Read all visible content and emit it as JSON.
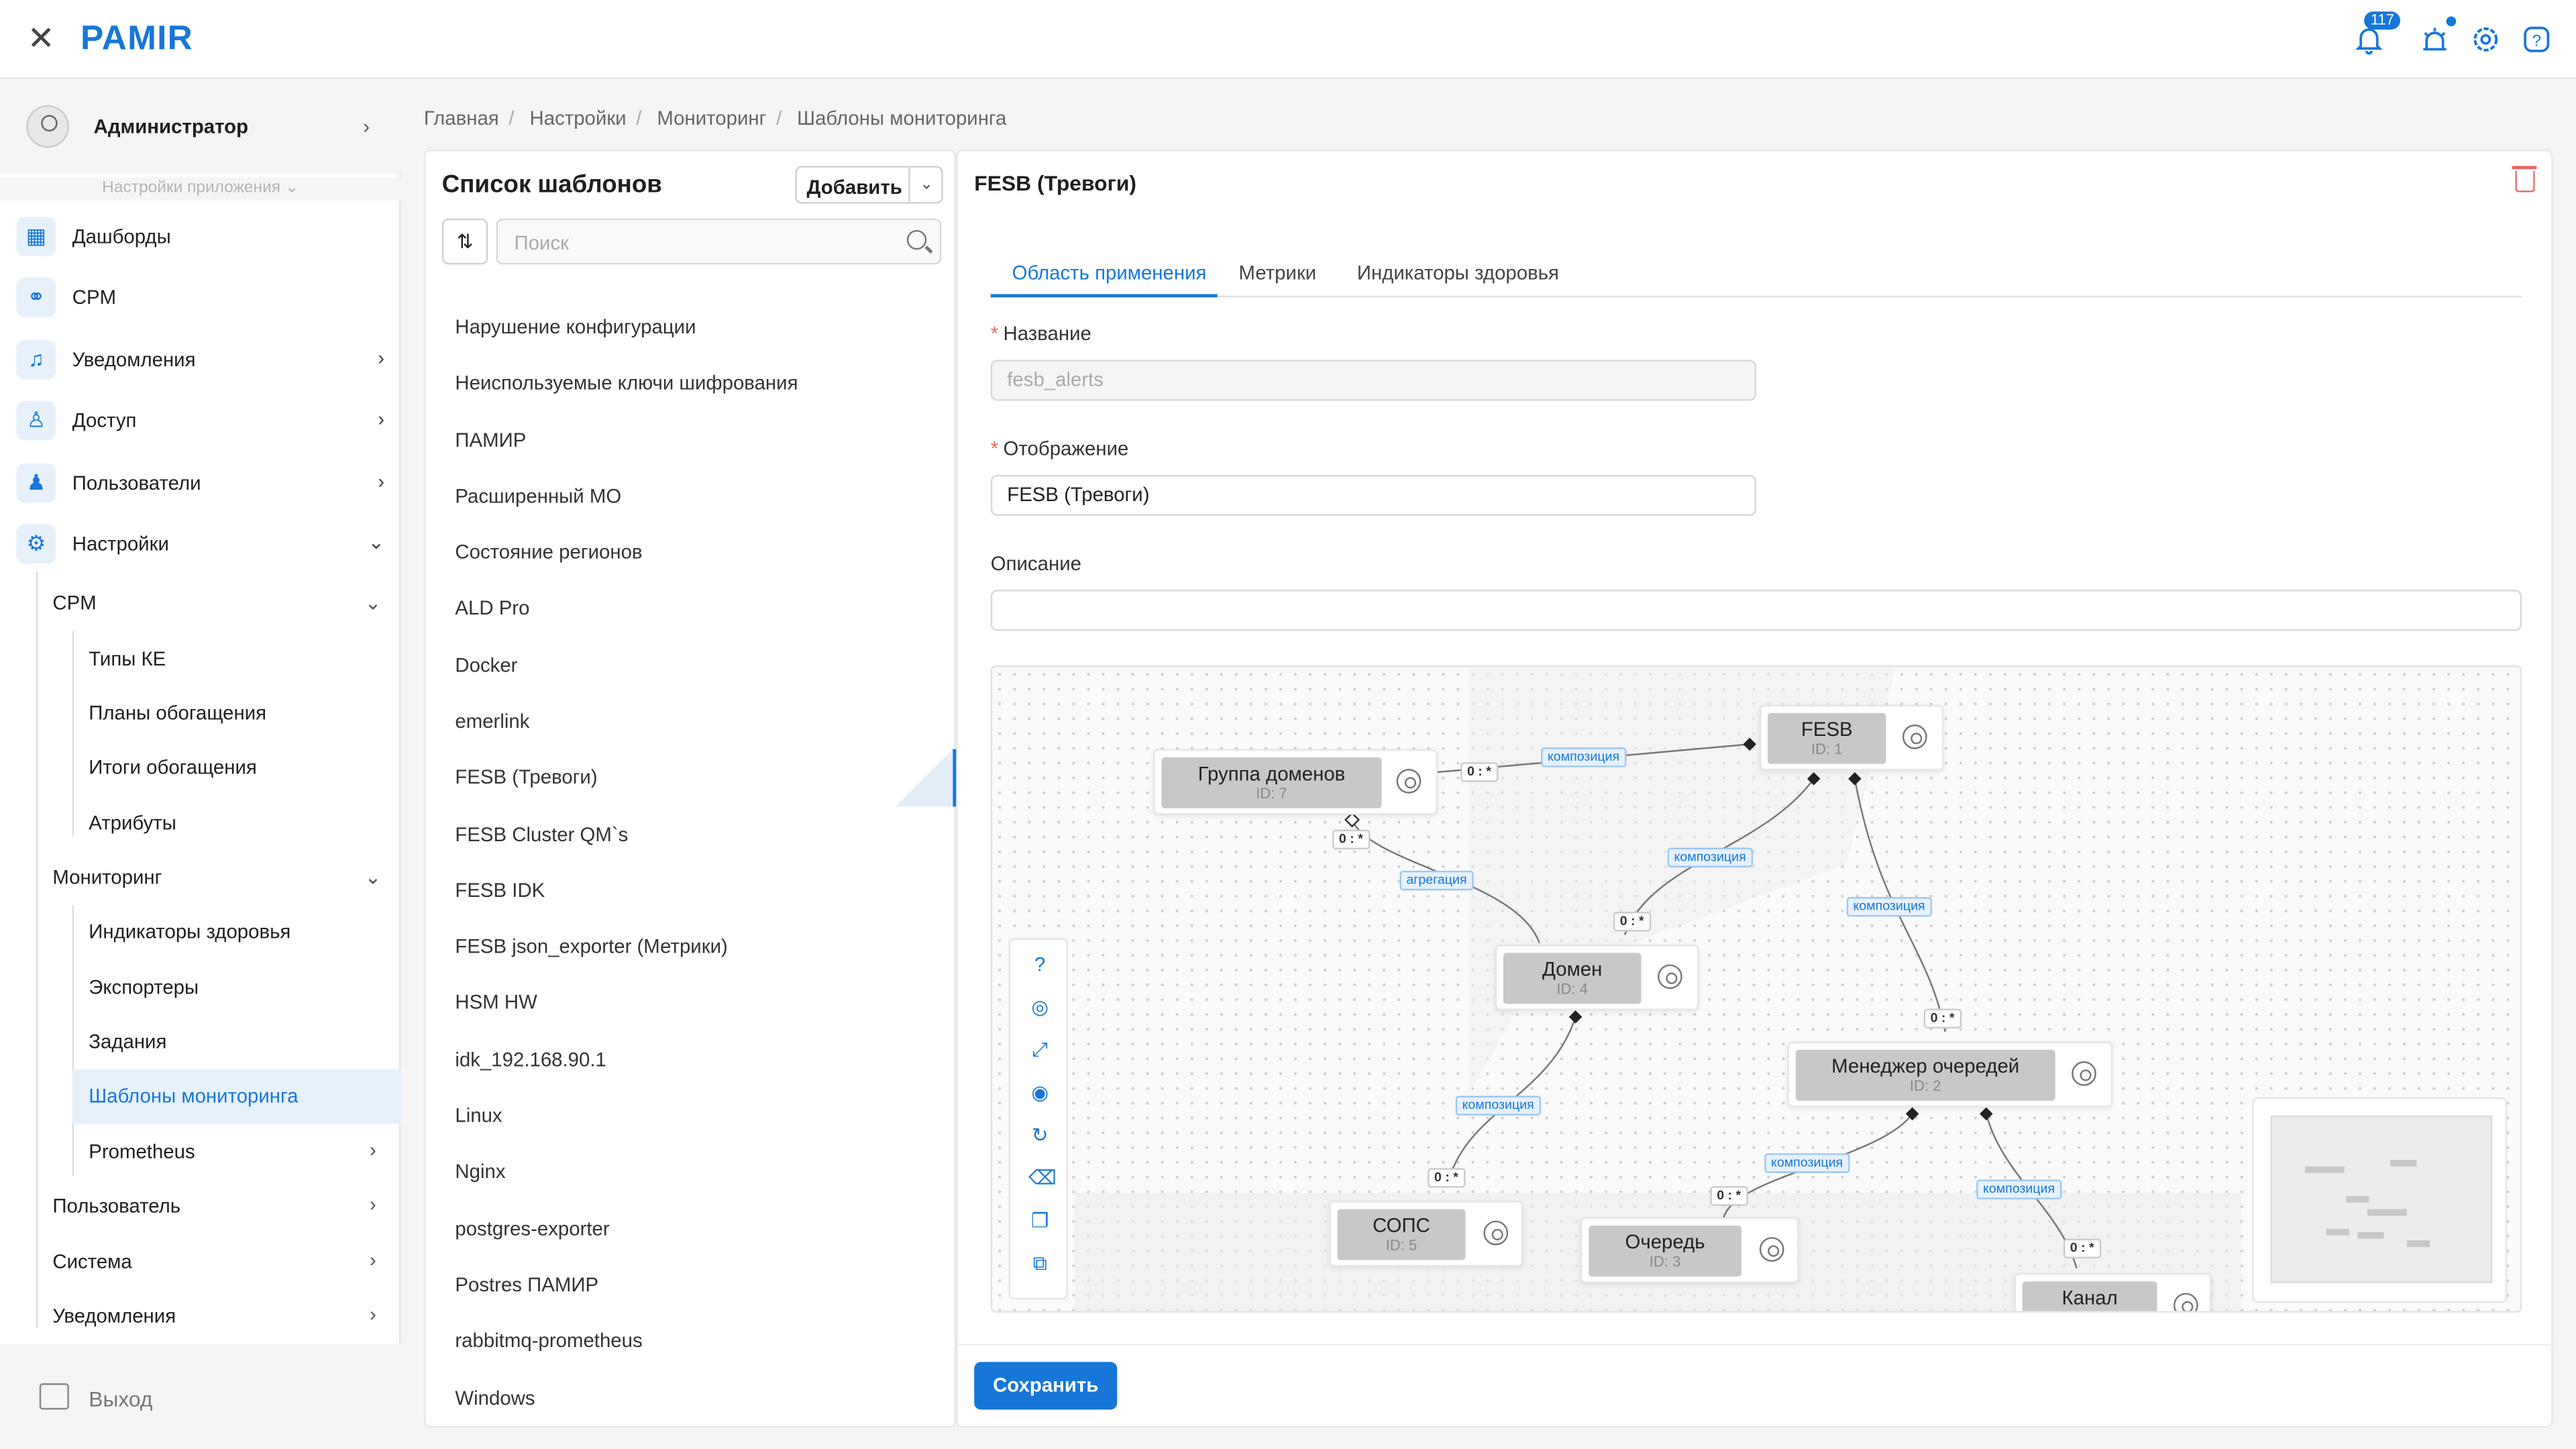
{
  "app": {
    "logo": "PAMIR",
    "notifications_count": "117"
  },
  "sidebar": {
    "user": "Администратор",
    "app_settings": "Настройки приложения",
    "items": [
      {
        "label": "Дашборды",
        "icon": "dashboard-icon"
      },
      {
        "label": "CPM",
        "icon": "cpm-icon"
      },
      {
        "label": "Уведомления",
        "icon": "bell-icon"
      },
      {
        "label": "Доступ",
        "icon": "access-icon"
      },
      {
        "label": "Пользователи",
        "icon": "users-icon"
      },
      {
        "label": "Настройки",
        "icon": "gear-icon"
      }
    ],
    "sub": {
      "cpm": "CPM",
      "cpm_items": [
        "Типы КЕ",
        "Планы обогащения",
        "Итоги обогащения",
        "Атрибуты"
      ],
      "monitoring": "Мониторинг",
      "monitoring_items": [
        "Индикаторы здоровья",
        "Экспортеры",
        "Задания",
        "Шаблоны мониторинга",
        "Prometheus"
      ],
      "user": "Пользователь",
      "system": "Система",
      "notifications": "Уведомления"
    },
    "logout": "Выход"
  },
  "breadcrumbs": [
    "Главная",
    "Настройки",
    "Мониторинг",
    "Шаблоны мониторинга"
  ],
  "list": {
    "title": "Список шаблонов",
    "add_label": "Добавить",
    "search_placeholder": "Поиск",
    "items": [
      "Нарушение конфигурации",
      "Неиспользуемые ключи шифрования",
      "ПАМИР",
      "Расширенный МО",
      "Состояние регионов",
      "ALD Pro",
      "Docker",
      "emerlink",
      "FESB (Тревоги)",
      "FESB Cluster QM`s",
      "FESB IDK",
      "FESB json_exporter (Метрики)",
      "HSM HW",
      "idk_192.168.90.1",
      "Linux",
      "Nginx",
      "postgres-exporter",
      "Postres ПАМИР",
      "rabbitmq-prometheus",
      "Windows"
    ]
  },
  "editor": {
    "title": "FESB (Тревоги)",
    "tabs": [
      "Область применения",
      "Метрики",
      "Индикаторы здоровья"
    ],
    "name_label": "Название",
    "name_value": "fesb_alerts",
    "display_label": "Отображение",
    "display_value": "FESB (Тревоги)",
    "description_label": "Описание",
    "description_value": "",
    "save_label": "Сохранить"
  },
  "diagram": {
    "nodes": [
      {
        "key": "fesb",
        "title": "FESB",
        "id": "ID: 1"
      },
      {
        "key": "group",
        "title": "Группа доменов",
        "id": "ID: 7"
      },
      {
        "key": "domain",
        "title": "Домен",
        "id": "ID: 4"
      },
      {
        "key": "qm",
        "title": "Менеджер очередей",
        "id": "ID: 2"
      },
      {
        "key": "sops",
        "title": "СОПС",
        "id": "ID: 5"
      },
      {
        "key": "queue",
        "title": "Очередь",
        "id": "ID: 3"
      },
      {
        "key": "channel",
        "title": "Канал",
        "id": ""
      }
    ],
    "edge_labels": {
      "composition": "композиция",
      "aggregation": "агрегация"
    },
    "cardinality": "0 : *"
  },
  "colors": {
    "accent": "#1677d9",
    "danger": "#e66666"
  }
}
